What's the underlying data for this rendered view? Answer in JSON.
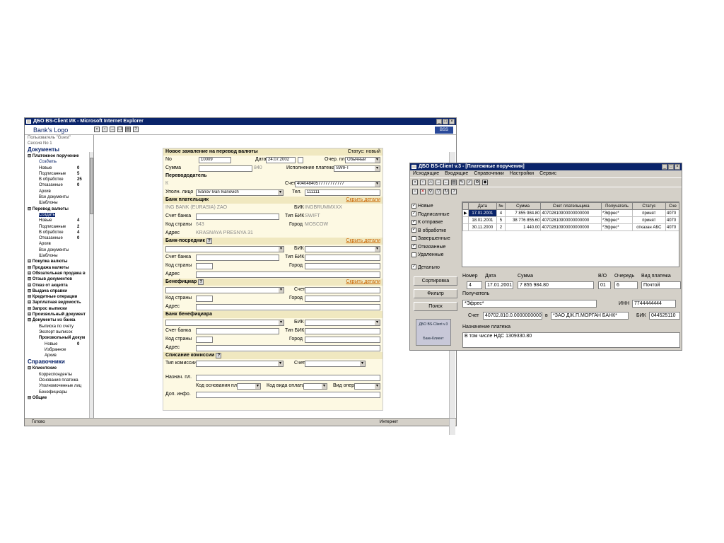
{
  "ie": {
    "title": "ДБО BS-Client ИК - Microsoft Internet Explorer",
    "logo": "Bank's Logo",
    "status": "Готово",
    "zone": "Интернет",
    "user": "Пользователь \"Guest\"",
    "session": "Сессия No 1",
    "docs_header": "Документы",
    "refs_header": "Справочники",
    "tree": [
      {
        "t": "Платежное поручение",
        "l": 0
      },
      {
        "t": "Создать",
        "l": 1,
        "ital": true
      },
      {
        "t": "Новые",
        "l": 1,
        "n": "0"
      },
      {
        "t": "Подписанные",
        "l": 1,
        "n": "5"
      },
      {
        "t": "В обработке",
        "l": 1,
        "n": "25"
      },
      {
        "t": "Отказанные",
        "l": 1,
        "n": "0"
      },
      {
        "t": "Архив",
        "l": 1
      },
      {
        "t": "Все документы",
        "l": 1
      },
      {
        "t": "Шаблоны",
        "l": 1
      },
      {
        "t": "Перевод валюты",
        "l": 0
      },
      {
        "t": "Создать",
        "l": 1,
        "sel": true
      },
      {
        "t": "Новые",
        "l": 1,
        "n": "4"
      },
      {
        "t": "Подписанные",
        "l": 1,
        "n": "2"
      },
      {
        "t": "В обработке",
        "l": 1,
        "n": "4"
      },
      {
        "t": "Отказанные",
        "l": 1,
        "n": "0"
      },
      {
        "t": "Архив",
        "l": 1
      },
      {
        "t": "Все документы",
        "l": 1
      },
      {
        "t": "Шаблоны",
        "l": 1
      },
      {
        "t": "Покупка валюты",
        "l": 0
      },
      {
        "t": "Продажа валюты",
        "l": 0
      },
      {
        "t": "Обязательная продажа в",
        "l": 0
      },
      {
        "t": "Отзыв документов",
        "l": 0
      },
      {
        "t": "Отказ от акцепта",
        "l": 0
      },
      {
        "t": "Выдача справки",
        "l": 0
      },
      {
        "t": "Кредитные операции",
        "l": 0
      },
      {
        "t": "Зарплатная ведомость",
        "l": 0
      },
      {
        "t": "Запрос выписки",
        "l": 0
      },
      {
        "t": "Произвольный документ",
        "l": 0
      },
      {
        "t": "Документы из банка",
        "l": 0
      },
      {
        "t": "Выписка по счету",
        "l": 1
      },
      {
        "t": "Экспорт выписок",
        "l": 1
      },
      {
        "t": "Произвольный докум",
        "l": 1,
        "b": true
      },
      {
        "t": "Новые",
        "l": 2,
        "n": "0"
      },
      {
        "t": "Избранное",
        "l": 2
      },
      {
        "t": "Архив",
        "l": 2
      }
    ],
    "refs": [
      {
        "t": "Клиентские",
        "l": 0
      },
      {
        "t": "Корреспонденты",
        "l": 1
      },
      {
        "t": "Основания платежа",
        "l": 1
      },
      {
        "t": "Уполномоченные лиц",
        "l": 1
      },
      {
        "t": "Бенефициары",
        "l": 1
      },
      {
        "t": "Общие",
        "l": 0
      }
    ]
  },
  "form": {
    "title": "Новое заявление на перевод валюты",
    "status": "Статус: новый",
    "no_label": "No",
    "no": "10009",
    "date_label": "Дата",
    "date": "24.07.2002",
    "queue_label": "Очер. пл.",
    "queue": "Обычный",
    "sum_label": "Сумма",
    "sum_code": "840",
    "exec_label": "Исполнение платежа",
    "exec": "SWIFT",
    "sender_section": "Перевододатель",
    "sender_k": "К",
    "account_label": "Счет",
    "account": "40404840577777777777",
    "auth_label": "Уполн. лицо",
    "auth": "Ivanov Ivan Ivanovich",
    "tel_label": "Тел.",
    "tel": "111111",
    "payer_bank": "Банк плательщик",
    "hide": "Скрыть детали",
    "payer_bank_name": "ING BANK (EURASIA) ZAO",
    "bic_label": "БИК",
    "payer_bic": "INGBRUMMXXX",
    "bank_acc_label": "Счет банка",
    "bic_type_label": "Тип БИК",
    "bic_type": "SWIFT",
    "country_label": "Код страны",
    "country": "643",
    "city_label": "Город",
    "city": "MOSCOW",
    "addr_label": "Адрес",
    "addr": "KRASNAYA PRESNYA 31",
    "intermediary": "Банк-посредник",
    "beneficiary": "Бенефициар",
    "benef_bank": "Банк бенефициара",
    "commission": "Списание комиссии",
    "comm_type": "Тип комиссии",
    "purpose": "Назнач. пл.",
    "basis_code": "Код основания пл",
    "optype_code": "Код вида оплаты",
    "op_type": "Вид опер",
    "extra_info": "Доп. инфо.",
    "q": "?"
  },
  "bs": {
    "title": "ДБО BS-Client v.3 - [Платежные поручения]",
    "menu": [
      "Исходящие",
      "Входящие",
      "Справочники",
      "Настройки",
      "Сервис"
    ],
    "filters": [
      {
        "label": "Новые",
        "checked": true
      },
      {
        "label": "Подписанные",
        "checked": true
      },
      {
        "label": "К отправке",
        "checked": true
      },
      {
        "label": "В обработке",
        "checked": true
      },
      {
        "label": "Завершенные",
        "checked": false
      },
      {
        "label": "Отказанные",
        "checked": true
      },
      {
        "label": "Удаленные",
        "checked": false
      }
    ],
    "detail": "Детально",
    "btn_sort": "Сортировка",
    "btn_filter": "Фильтр",
    "btn_search": "Поиск",
    "logo_text": "ДБО BS-Client v.3",
    "logo_sub": "Банк-Клиент",
    "columns": [
      "Дата",
      "№",
      "Сумма",
      "Счет плательщика",
      "Получатель",
      "Статус",
      "Сче"
    ],
    "rows": [
      {
        "date": "17.01.2001",
        "no": "4",
        "sum": "7 855 984.80",
        "acc": "40702810900000000000",
        "rec": "*Эфрес*",
        "status": "принят",
        "c": "4070"
      },
      {
        "date": "18.01.2001",
        "no": "5",
        "sum": "38 776 855.60",
        "acc": "40702810900000000000",
        "rec": "*Эфрес*",
        "status": "принят",
        "c": "4070"
      },
      {
        "date": "30.11.2000",
        "no": "2",
        "sum": "1 440.00",
        "acc": "40702810900000000000",
        "rec": "*Эфрес*",
        "status": "отказан АБС",
        "c": "4070"
      }
    ],
    "labels": {
      "number": "Номер",
      "date": "Дата",
      "sum": "Сумма",
      "vo": "В/О",
      "queue": "Очередь",
      "pay_type": "Вид платежа",
      "recipient": "Получатель",
      "inn": "ИНН",
      "account": "Счет",
      "in": "в",
      "bic": "БИК",
      "purpose": "Назначение платежа"
    },
    "detail_vals": {
      "number": "4",
      "date": "17.01.2001",
      "sum": "7 855 984.80",
      "vo": "01",
      "queue": "6",
      "pay_type": "Почтой",
      "recipient": "*Эфрес*",
      "inn": "7744444444",
      "account": "40702.810.0.00000000000",
      "bank": "*ЗАО ДЖ.П.МОРГАН БАНК*",
      "bic": "044525110",
      "purpose": "В том числе НДС 1309330.80"
    }
  }
}
